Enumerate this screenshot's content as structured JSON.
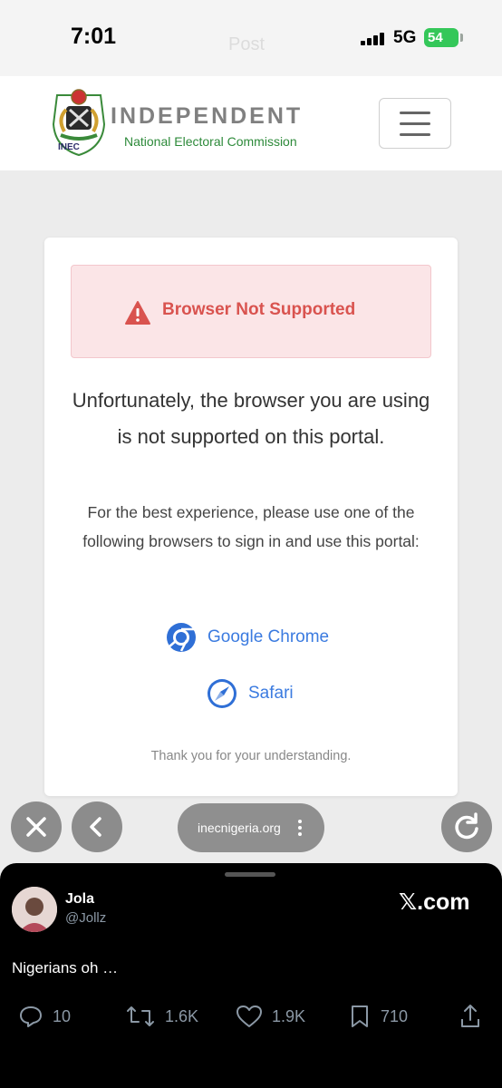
{
  "status_bar": {
    "time": "7:01",
    "ghost_title": "Post",
    "network": "5G",
    "battery": "54"
  },
  "header": {
    "logo_text": "INEC",
    "brand_line1": "INDEPENDENT",
    "brand_line2": "National Electoral Commission",
    "menu_icon": "hamburger-icon"
  },
  "card": {
    "alert_title": "Browser Not Supported",
    "message_primary": "Unfortunately, the browser you are using is not supported on this portal.",
    "message_secondary": "For the best experience, please use one of the following browsers to sign in and use this portal:",
    "browsers": [
      {
        "label": "Google Chrome",
        "icon": "chrome-icon"
      },
      {
        "label": "Safari",
        "icon": "safari-icon"
      }
    ],
    "thanks": "Thank you for your understanding."
  },
  "browser_bar": {
    "url": "inecnigeria.org"
  },
  "tweet": {
    "user_name": "Jola",
    "handle": "@Jollz",
    "source": "𝕏.com",
    "text": "Nigerians oh …",
    "replies": "10",
    "reposts": "1.6K",
    "likes": "1.9K",
    "bookmarks": "710"
  },
  "colors": {
    "alert_bg": "#fbe5e7",
    "alert_text": "#d9534f",
    "link_blue": "#3b7be0",
    "inec_green": "#2d8a3a",
    "battery_green": "#34c759"
  }
}
